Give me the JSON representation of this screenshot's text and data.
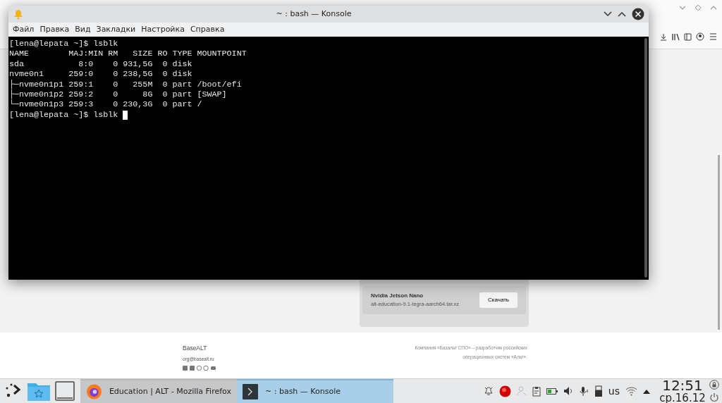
{
  "konsole": {
    "title": "~ : bash — Konsole",
    "menu": [
      "Файл",
      "Правка",
      "Вид",
      "Закладки",
      "Настройка",
      "Справка"
    ],
    "lines": [
      "[lena@lepata ~]$ lsblk",
      "NAME        MAJ:MIN RM   SIZE RO TYPE MOUNTPOINT",
      "sda           8:0    0 931,5G  0 disk",
      "nvme0n1     259:0    0 238,5G  0 disk",
      "├─nvme0n1p1 259:1    0   255M  0 part /boot/efi",
      "├─nvme0n1p2 259:2    0     8G  0 part [SWAP]",
      "└─nvme0n1p3 259:3    0 230,3G  0 part /",
      "[lena@lepata ~]$ lsblk "
    ]
  },
  "browser": {
    "download": {
      "name": "Nvidia Jetson Nano",
      "file": "alt-education-9.1-tegra-aarch64.tar.xz",
      "button": "Скачать"
    },
    "footer": {
      "brand": "BaseALT",
      "email": "org@basealt.ru",
      "about": "Компания «Базальт СПО» – разработчик российских операционных систем «Альт»."
    }
  },
  "taskbar": {
    "tasks": [
      {
        "label": "Education | ALT - Mozilla Firefox",
        "kind": "firefox",
        "selected": false
      },
      {
        "label": "~ : bash — Konsole",
        "kind": "terminal",
        "selected": true
      }
    ],
    "layout": "us",
    "time": "12:51",
    "date": "ср.16.12"
  }
}
